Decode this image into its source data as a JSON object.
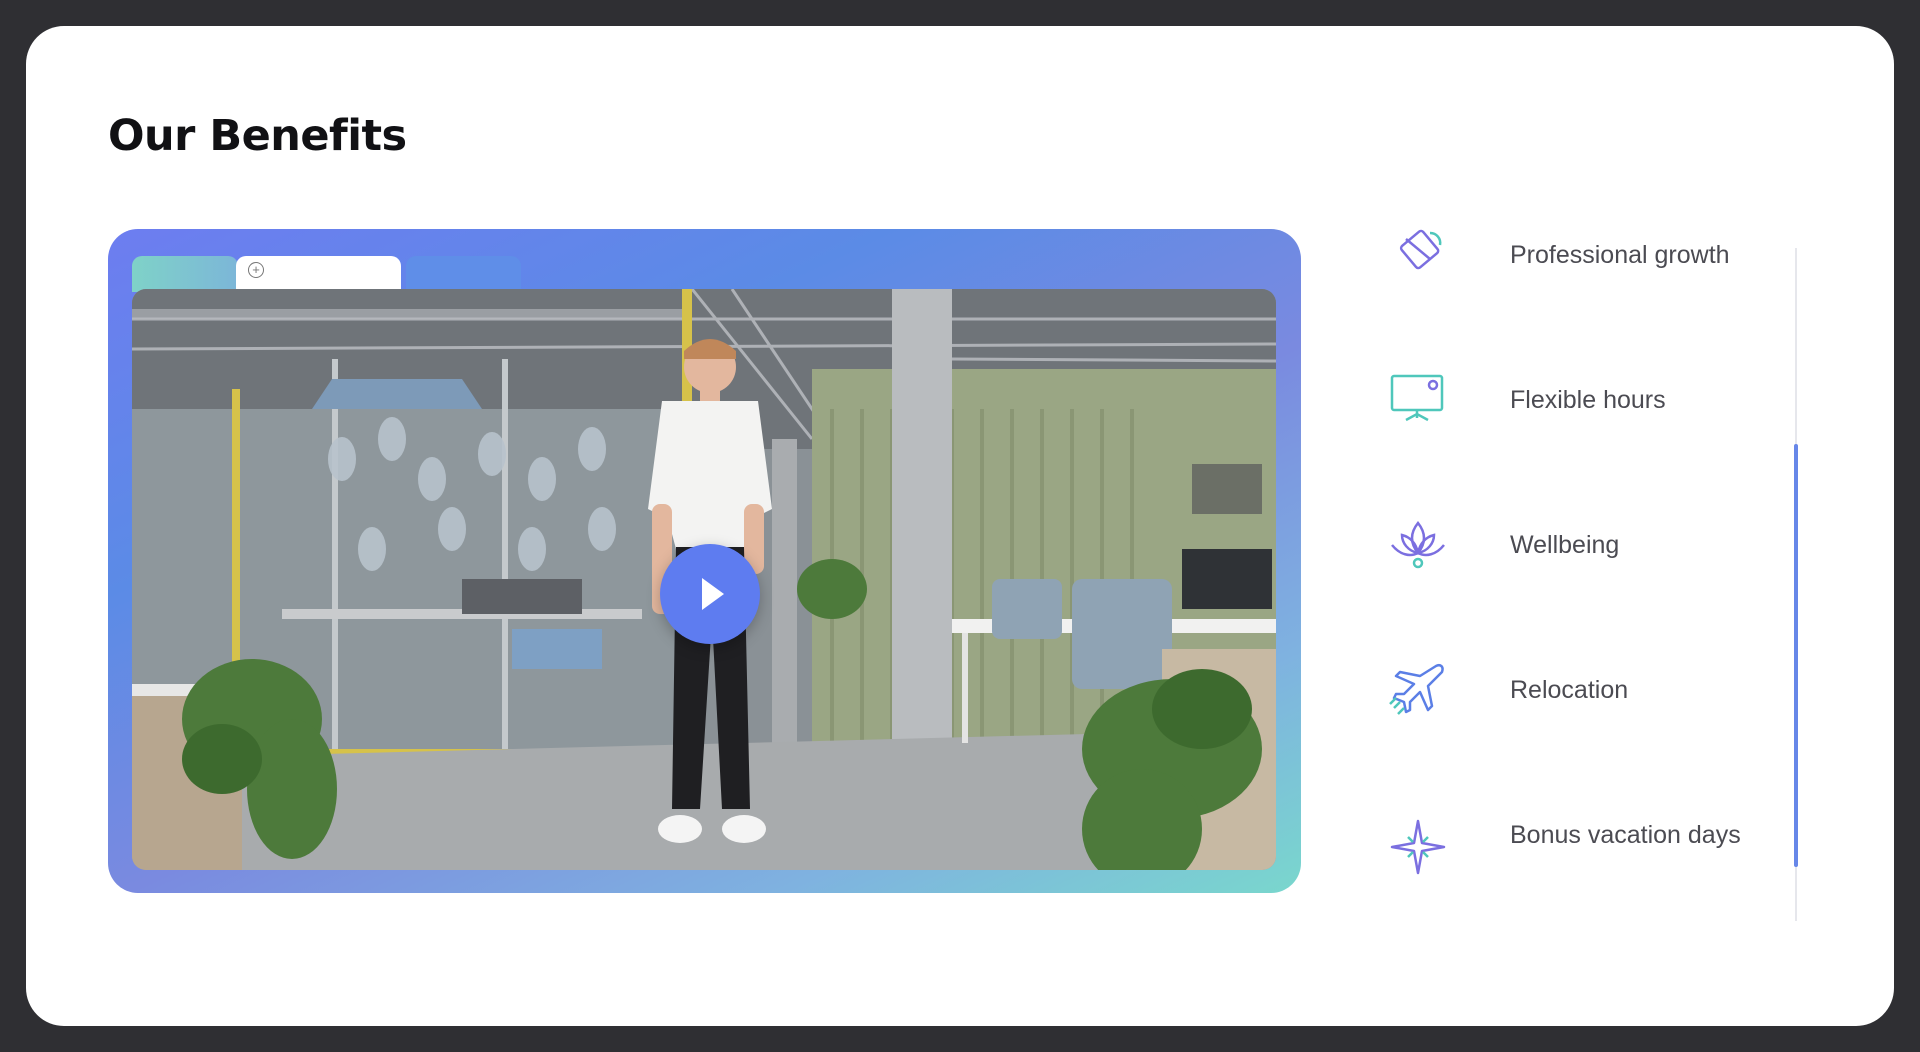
{
  "page": {
    "title": "Our Benefits"
  },
  "video": {
    "play_label": "Play video",
    "accent_color": "#5e7cf0"
  },
  "benefits": {
    "items": [
      {
        "label": "Professional growth",
        "icon": "growth-icon"
      },
      {
        "label": "Flexible hours",
        "icon": "monitor-icon"
      },
      {
        "label": "Wellbeing",
        "icon": "lotus-icon"
      },
      {
        "label": "Relocation",
        "icon": "airplane-icon"
      },
      {
        "label": "Bonus vacation days",
        "icon": "sparkle-icon"
      }
    ]
  },
  "colors": {
    "icon_purple": "#7b6fe0",
    "icon_teal": "#4fc7bb",
    "scroll_thumb": "#6787e8"
  }
}
